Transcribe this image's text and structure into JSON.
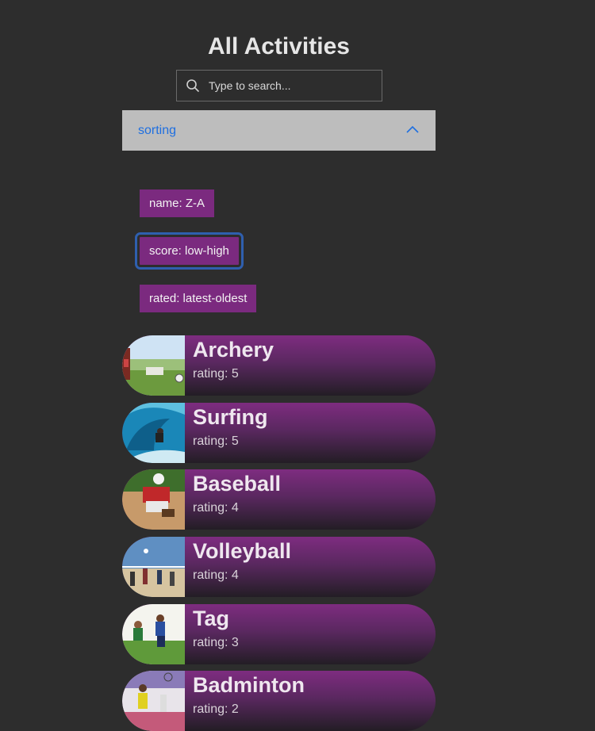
{
  "page_title": "All Activities",
  "search": {
    "placeholder": "Type to search..."
  },
  "sorting": {
    "label": "sorting",
    "options": [
      "name: Z-A",
      "score: low-high",
      "rated: latest-oldest"
    ]
  },
  "activities": [
    {
      "name": "Archery",
      "rating": "rating: 5"
    },
    {
      "name": "Surfing",
      "rating": "rating: 5"
    },
    {
      "name": "Baseball",
      "rating": "rating: 4"
    },
    {
      "name": "Volleyball",
      "rating": "rating: 4"
    },
    {
      "name": "Tag",
      "rating": "rating: 3"
    },
    {
      "name": "Badminton",
      "rating": "rating: 2"
    }
  ],
  "colors": {
    "background": "#2d2d2d",
    "accent_purple": "#7b2a7f",
    "link_blue": "#1f6fe0",
    "accordion_bg": "#bdbdbd",
    "focus_ring": "#2f5fae"
  }
}
